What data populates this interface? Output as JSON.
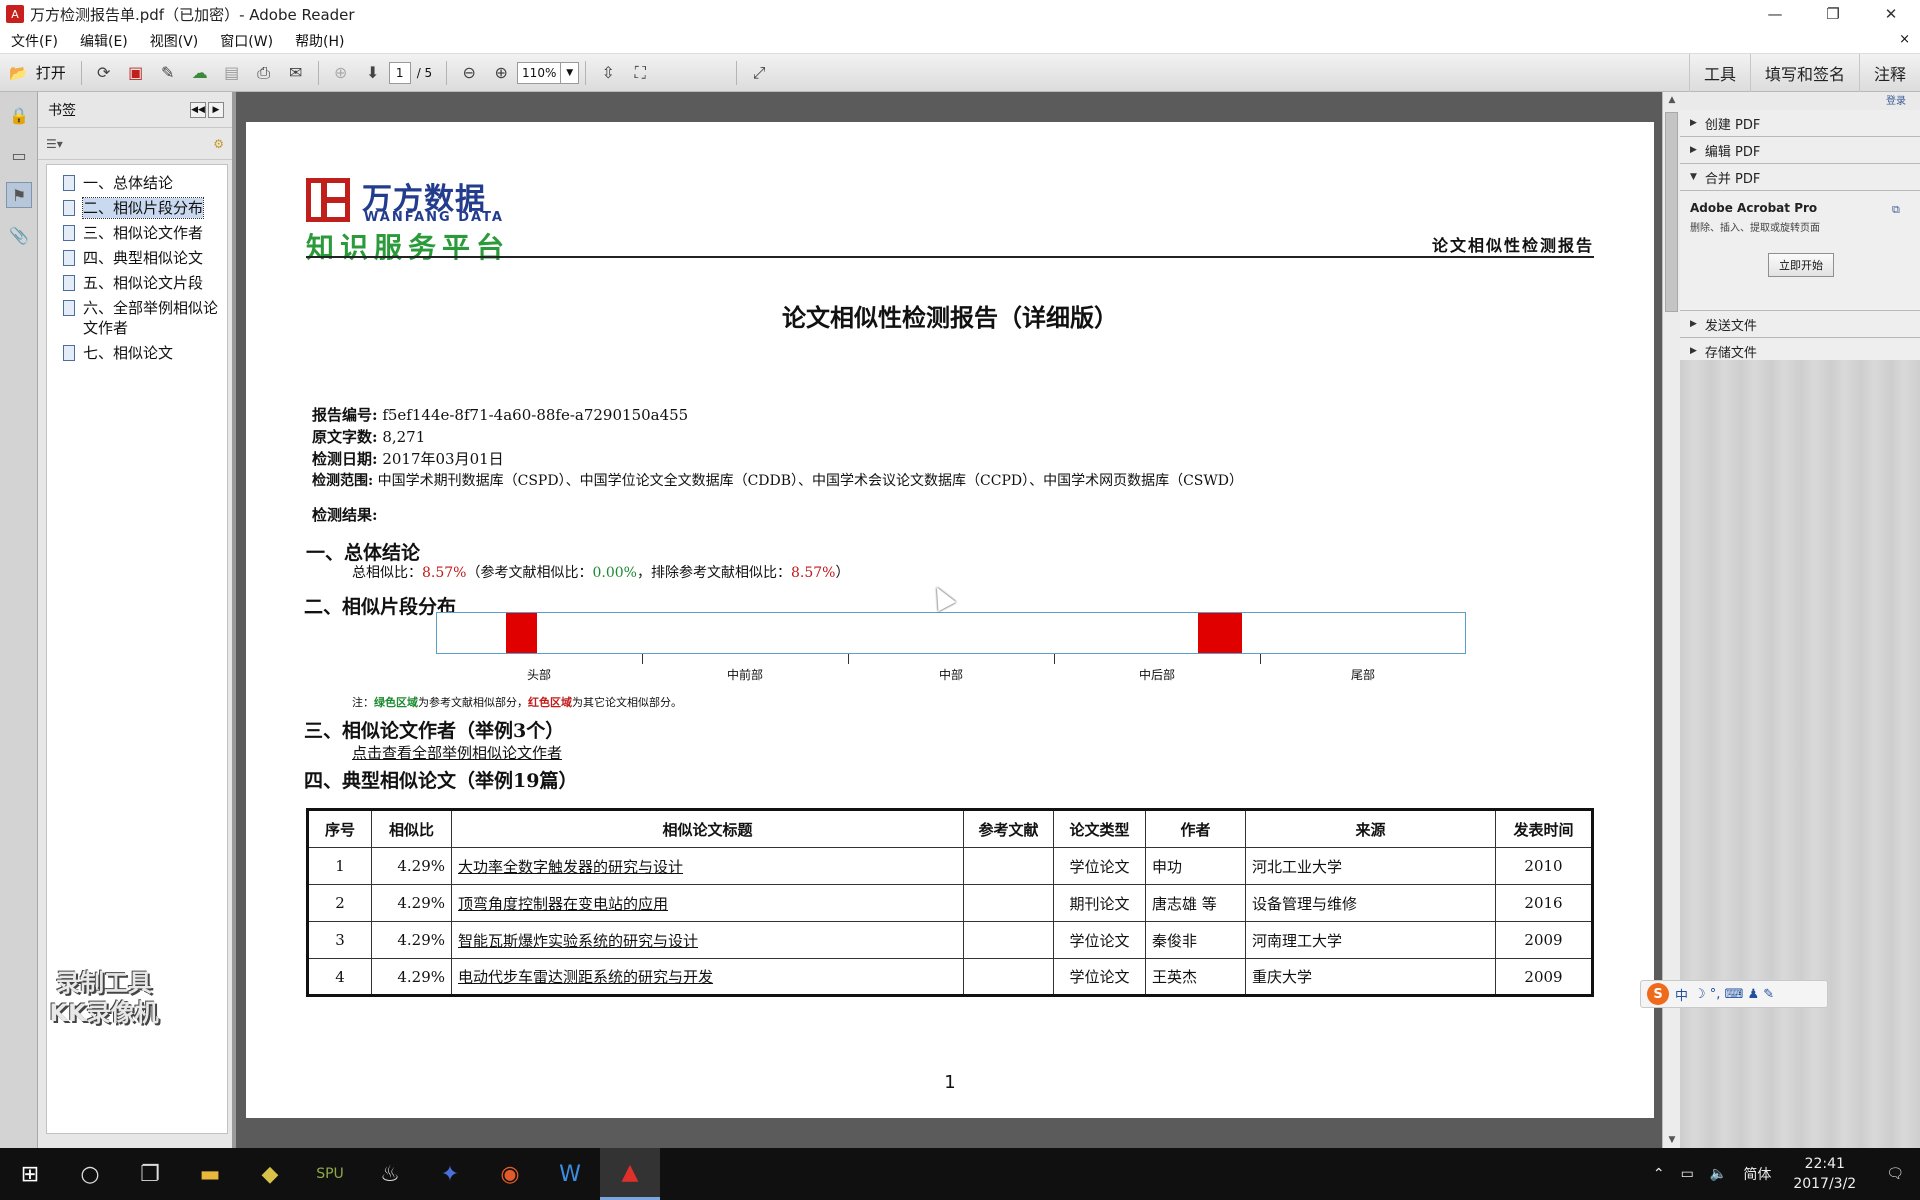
{
  "window": {
    "title": "万方检测报告单.pdf（已加密）- Adobe Reader",
    "min": "—",
    "restore": "❐",
    "close": "✕"
  },
  "menu": [
    "文件(F)",
    "编辑(E)",
    "视图(V)",
    "窗口(W)",
    "帮助(H)"
  ],
  "menu_close": "×",
  "toolbar": {
    "open_label": "打开",
    "page_current": "1",
    "page_total": "/ 5",
    "zoom": "110%",
    "right_links": [
      "工具",
      "填写和签名",
      "注释"
    ]
  },
  "bookmarks": {
    "title": "书签",
    "items": [
      {
        "label": "一、总体结论",
        "selected": false
      },
      {
        "label": "二、相似片段分布",
        "selected": true
      },
      {
        "label": "三、相似论文作者",
        "selected": false
      },
      {
        "label": "四、典型相似论文",
        "selected": false
      },
      {
        "label": "五、相似论文片段",
        "selected": false
      },
      {
        "label": "六、全部举例相似论文作者",
        "selected": false
      },
      {
        "label": "七、相似论文",
        "selected": false
      }
    ]
  },
  "report": {
    "logo_cn": "万方数据",
    "logo_en": "WANFANG DATA",
    "logo_slogan": "知识服务平台",
    "header_right": "论文相似性检测报告",
    "title": "论文相似性检测报告（详细版）",
    "meta": [
      {
        "label": "报告编号:",
        "value": "f5ef144e-8f71-4a60-88fe-a7290150a455"
      },
      {
        "label": "原文字数:",
        "value": "8,271"
      },
      {
        "label": "检测日期:",
        "value": "2017年03月01日"
      },
      {
        "label": "检测范围:",
        "value": "中国学术期刊数据库（CSPD）、中国学位论文全文数据库（CDDB）、中国学术会议论文数据库（CCPD）、中国学术网页数据库（CSWD）"
      }
    ],
    "result_label": "检测结果:",
    "sec1": "一、总体结论",
    "overall": {
      "p1": "总相似比：",
      "v1": "8.57%",
      "p2": "（参考文献相似比：",
      "v2": "0.00%",
      "p3": "，排除参考文献相似比：",
      "v3": "8.57%",
      "p4": "）"
    },
    "sec2": "二、相似片段分布",
    "distribution": {
      "red_segments": [
        {
          "start": 0.067,
          "end": 0.097
        },
        {
          "start": 0.74,
          "end": 0.783
        }
      ],
      "labels": [
        "头部",
        "中前部",
        "中部",
        "中后部",
        "尾部"
      ]
    },
    "note": {
      "p1": "注：",
      "green": "绿色区域",
      "p2": "为参考文献相似部分，",
      "red": "红色区域",
      "p3": "为其它论文相似部分。"
    },
    "sec3": "三、相似论文作者（举例3个）",
    "sec3_link": "点击查看全部举例相似论文作者",
    "sec4": "四、典型相似论文（举例19篇）",
    "table": {
      "headers": [
        "序号",
        "相似比",
        "相似论文标题",
        "参考文献",
        "论文类型",
        "作者",
        "来源",
        "发表时间"
      ],
      "rows": [
        [
          "1",
          "4.29%",
          "大功率全数字触发器的研究与设计",
          "",
          "学位论文",
          "申功",
          "河北工业大学",
          "2010"
        ],
        [
          "2",
          "4.29%",
          "顶弯角度控制器在变电站的应用",
          "",
          "期刊论文",
          "唐志雄 等",
          "设备管理与维修",
          "2016"
        ],
        [
          "3",
          "4.29%",
          "智能瓦斯爆炸实验系统的研究与设计",
          "",
          "学位论文",
          "秦俊非",
          "河南理工大学",
          "2009"
        ],
        [
          "4",
          "4.29%",
          "电动代步车雷达测距系统的研究与开发",
          "",
          "学位论文",
          "王英杰",
          "重庆大学",
          "2009"
        ]
      ]
    },
    "page_number": "1"
  },
  "tools_pane": {
    "top_link": "登录",
    "sections_top": [
      "创建 PDF",
      "编辑 PDF",
      "合并 PDF"
    ],
    "acrobat_title": "Adobe Acrobat Pro",
    "acrobat_desc": "删除、插入、提取或旋转页面",
    "acrobat_button": "立即开始",
    "sections_bottom": [
      "发送文件",
      "存储文件"
    ]
  },
  "ime": {
    "logo": "S",
    "mode": "中",
    "icons": "☽ °, ⌨ ♟ ✎"
  },
  "watermark": [
    "录制工具",
    "KK录像机"
  ],
  "taskbar": {
    "lang": "简体",
    "time": "22:41",
    "date": "2017/3/2"
  }
}
